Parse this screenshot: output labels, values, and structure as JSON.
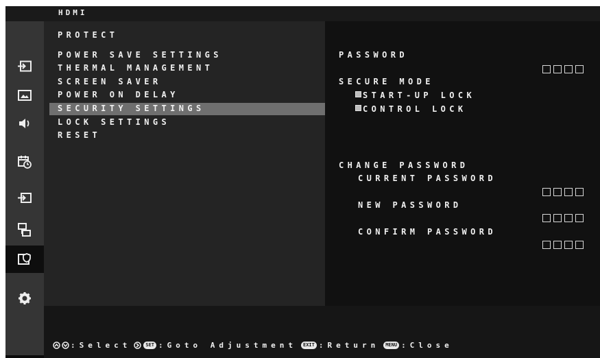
{
  "source": "HDMI",
  "sidebar": {
    "items": [
      {
        "icon": "input-icon"
      },
      {
        "icon": "picture-icon"
      },
      {
        "icon": "audio-icon"
      },
      {
        "icon": "schedule-icon"
      },
      {
        "icon": "multi-input-icon"
      },
      {
        "icon": "network-icon"
      },
      {
        "icon": "protect-icon",
        "active": true
      },
      {
        "icon": "gear-icon"
      }
    ]
  },
  "left_menu": {
    "title": "PROTECT",
    "items": [
      "POWER SAVE SETTINGS",
      "THERMAL MANAGEMENT",
      "SCREEN SAVER",
      "POWER ON DELAY",
      "SECURITY SETTINGS",
      "LOCK SETTINGS",
      "RESET"
    ],
    "selected_index": 4
  },
  "right_panel": {
    "password_label": "PASSWORD",
    "secure_mode_label": "SECURE MODE",
    "startup_lock_label": "START-UP LOCK",
    "control_lock_label": "CONTROL LOCK",
    "change_password_label": "CHANGE PASSWORD",
    "current_password_label": "CURRENT PASSWORD",
    "new_password_label": "NEW PASSWORD",
    "confirm_password_label": "CONFIRM PASSWORD"
  },
  "footer": {
    "select_text": ":Select",
    "set_key": "SET",
    "goto_text": ":Goto Adjustment",
    "exit_key": "EXIT",
    "return_text": ":Return",
    "menu_key": "MENU",
    "close_text": ":Close"
  }
}
